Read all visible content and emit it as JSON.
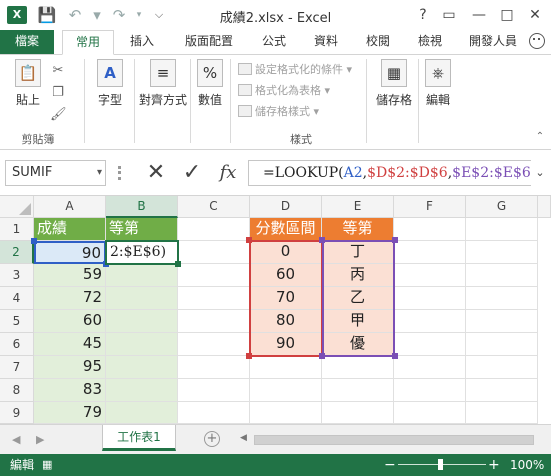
{
  "window": {
    "title": "成績2.xlsx - Excel",
    "app_icon": "X",
    "colors": {
      "brand": "#217346",
      "header_green": "#70ad47",
      "header_orange": "#ed7d31"
    }
  },
  "quick_access": {
    "icons": [
      "save-icon",
      "undo-icon",
      "redo-icon",
      "customize-icon"
    ]
  },
  "window_controls": {
    "help": "?",
    "ribbon_options": "▭",
    "minimize": "—",
    "maximize": "□",
    "close": "✕"
  },
  "ribbon_tabs": [
    "檔案",
    "常用",
    "插入",
    "版面配置",
    "公式",
    "資料",
    "校閱",
    "檢視",
    "開發人員"
  ],
  "ribbon": {
    "clipboard": {
      "paste": "貼上",
      "label": "剪貼簿"
    },
    "font": "字型",
    "alignment": "對齊方式",
    "number": {
      "label": "數值",
      "icon": "%"
    },
    "styles": {
      "conditional": "設定格式化的條件",
      "as_table": "格式化為表格",
      "cell_styles": "儲存格樣式",
      "label": "樣式"
    },
    "cells": "儲存格",
    "editing": "編輯"
  },
  "formula_bar": {
    "name_box": "SUMIF",
    "formula_parts": [
      "=LOOKUP(",
      "A2",
      ",",
      "$D$2:$D$6",
      ",",
      "$E$2:$E$6",
      ")"
    ],
    "fx": "fx"
  },
  "columns": [
    "A",
    "B",
    "C",
    "D",
    "E",
    "F",
    "G"
  ],
  "rows": [
    "1",
    "2",
    "3",
    "4",
    "5",
    "6",
    "7",
    "8",
    "9"
  ],
  "sheet": {
    "A1": "成績",
    "B1": "等第",
    "A_values": [
      "90",
      "59",
      "72",
      "60",
      "45",
      "95",
      "83",
      "79"
    ],
    "B2_editing": "2:$E$6)",
    "D1": "分數區間",
    "E1": "等第",
    "D_values": [
      "0",
      "60",
      "70",
      "80",
      "90"
    ],
    "E_values": [
      "丁",
      "丙",
      "乙",
      "甲",
      "優"
    ]
  },
  "sheet_tabs": {
    "active": "工作表1",
    "add": "+"
  },
  "status_bar": {
    "mode": "編輯",
    "zoom": "100%"
  }
}
